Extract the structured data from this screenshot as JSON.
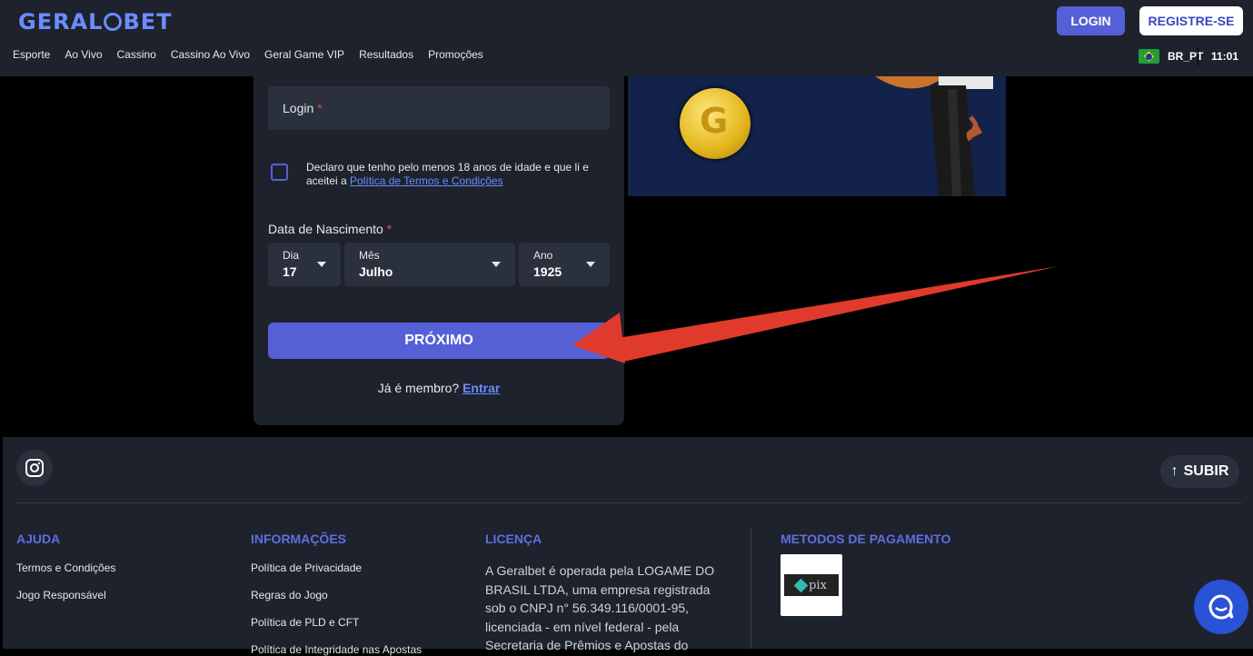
{
  "header": {
    "logo_text": "GERALGBET",
    "logo_left": "GERAL",
    "logo_right": "BET",
    "nav": [
      "Esporte",
      "Ao Vivo",
      "Cassino",
      "Cassino Ao Vivo",
      "Geral Game VIP",
      "Resultados",
      "Promoções"
    ],
    "login_label": "LOGIN",
    "register_label": "REGISTRE-SE",
    "language": "BR_PT",
    "time": "11:01"
  },
  "form": {
    "login_placeholder": "Login",
    "required_mark": "*",
    "declare_text": "Declaro que tenho pelo menos 18 anos de idade e que li e aceitei a ",
    "terms_link": "Política de Termos e Condições",
    "dob_label": "Data de Nascimento",
    "day_label": "Dia",
    "day_value": "17",
    "month_label": "Mês",
    "month_value": "Julho",
    "year_label": "Ano",
    "year_value": "1925",
    "next_label": "PRÓXIMO",
    "member_text": "Já é membro?",
    "enter_link": "Entrar"
  },
  "footer": {
    "up_label": "SUBIR",
    "help_title": "AJUDA",
    "help_links": [
      "Termos e Condições",
      "Jogo Responsável"
    ],
    "info_title": "INFORMAÇÕES",
    "info_links": [
      "Política de Privacidade",
      "Regras do Jogo",
      "Política de PLD e CFT",
      "Política de Integridade nas Apostas"
    ],
    "license_title": "LICENÇA",
    "license_text": "A Geralbet é operada pela LOGAME DO BRASIL LTDA, uma empresa registrada sob o CNPJ n° 56.349.116/0001-95, licenciada - em nível federal - pela Secretaria de Prêmios e Apostas do",
    "payment_title": "METODOS DE PAGAMENTO",
    "pix_text": "pix"
  },
  "colors": {
    "accent": "#5560d6",
    "header_bg": "#1e222d",
    "arrow": "#e03a2c"
  }
}
